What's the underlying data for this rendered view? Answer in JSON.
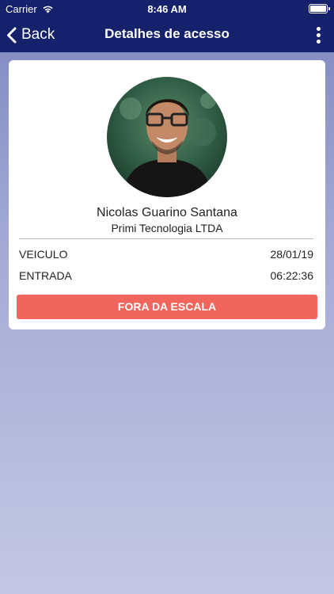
{
  "status_bar": {
    "carrier": "Carrier",
    "time": "8:46 AM"
  },
  "nav": {
    "back_label": "Back",
    "title": "Detalhes de acesso"
  },
  "person": {
    "name": "Nicolas Guarino Santana",
    "company": "Primi Tecnologia LTDA"
  },
  "details": [
    {
      "label": "VEICULO",
      "value": "28/01/19"
    },
    {
      "label": "ENTRADA",
      "value": "06:22:36"
    }
  ],
  "status_button": {
    "label": "FORA DA ESCALA"
  },
  "colors": {
    "header_bg": "#15226b",
    "status_button_bg": "#f0655c",
    "card_bg": "#ffffff"
  }
}
